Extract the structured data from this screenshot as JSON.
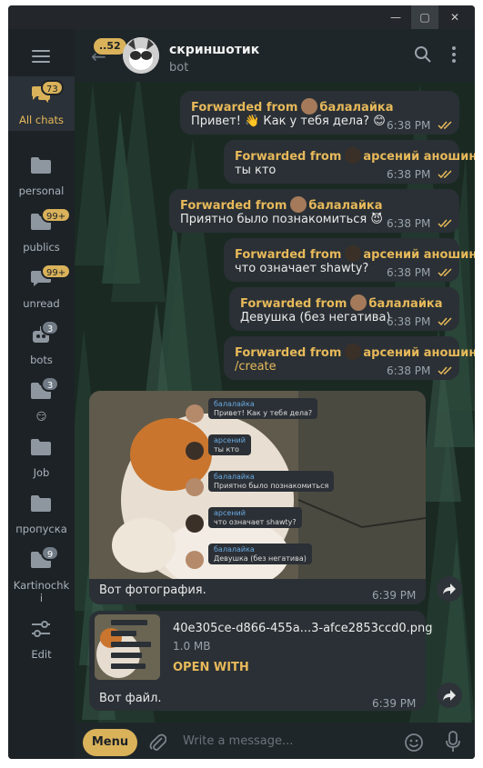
{
  "window": {
    "controls": {
      "minimize": "—",
      "maximize": "▢",
      "close": "✕"
    }
  },
  "sidebar": {
    "menu_icon": "hamburger-icon",
    "folders": [
      {
        "label": "All chats",
        "badge": "73",
        "badge_style": "gold",
        "icon": "chat-bubbles-icon",
        "active": true
      },
      {
        "label": "personal",
        "badge": "",
        "icon": "folder-icon"
      },
      {
        "label": "publics",
        "badge": "99+",
        "badge_style": "gold",
        "icon": "folder-icon"
      },
      {
        "label": "unread",
        "badge": "99+",
        "badge_style": "gold",
        "icon": "chat-bubble-icon"
      },
      {
        "label": "bots",
        "badge": "3",
        "badge_style": "grey",
        "icon": "bot-icon"
      },
      {
        "label": "😏",
        "badge": "3",
        "badge_style": "grey",
        "icon": "folder-icon"
      },
      {
        "label": "Job",
        "badge": "",
        "icon": "folder-icon"
      },
      {
        "label": "пропуска",
        "badge": "",
        "icon": "folder-icon"
      },
      {
        "label": "Kartinochk\ni",
        "badge": "9",
        "badge_style": "grey",
        "icon": "folder-icon"
      },
      {
        "label": "Edit",
        "badge": "",
        "icon": "sliders-icon"
      }
    ]
  },
  "header": {
    "back_badge": "..52",
    "title": "скриншотик",
    "subtitle": "bot",
    "search_icon": "search-icon",
    "more_icon": "more-vertical-icon"
  },
  "messages": [
    {
      "forwarded_prefix": "Forwarded from",
      "author": "балалайка",
      "text": "Привет! 👋 Как у тебя дела? 😊",
      "time": "6:38 PM"
    },
    {
      "forwarded_prefix": "Forwarded from",
      "author": "арсений аношин",
      "text": "ты кто",
      "time": "6:38 PM"
    },
    {
      "forwarded_prefix": "Forwarded from",
      "author": "балалайка",
      "text": "Приятно было познакомиться 😈",
      "time": "6:38 PM"
    },
    {
      "forwarded_prefix": "Forwarded from",
      "author": "арсений аношин",
      "text": "что означает shawty?",
      "time": "6:38 PM"
    },
    {
      "forwarded_prefix": "Forwarded from",
      "author": "балалайка",
      "text": "Девушка (без негатива)",
      "time": "6:38 PM"
    },
    {
      "forwarded_prefix": "Forwarded from",
      "author": "арсений аношин",
      "text": "/create",
      "time": "6:38 PM"
    }
  ],
  "photo_message": {
    "caption": "Вот фотография.",
    "time": "6:39 PM",
    "preview": [
      {
        "name": "балалайка",
        "text": "Привет!   Как у тебя дела?"
      },
      {
        "name": "арсений",
        "text": "ты кто"
      },
      {
        "name": "балалайка",
        "text": "Приятно было познакомиться"
      },
      {
        "name": "арсений",
        "text": "что означает shawty?"
      },
      {
        "name": "балалайка",
        "text": "Девушка (без негатива)"
      }
    ]
  },
  "file_message": {
    "file_name": "40e305ce-d866-455a...3-afce2853ccd0.png",
    "file_size": "1.0 MB",
    "action": "OPEN WITH",
    "caption": "Вот файл.",
    "time": "6:39 PM"
  },
  "input": {
    "menu_label": "Menu",
    "placeholder": "Write a message..."
  },
  "colors": {
    "accent": "#d9b25a",
    "sidebar_bg": "#1d2226",
    "bubble_bg": "#2a3035",
    "header_bg": "#1f2629"
  }
}
